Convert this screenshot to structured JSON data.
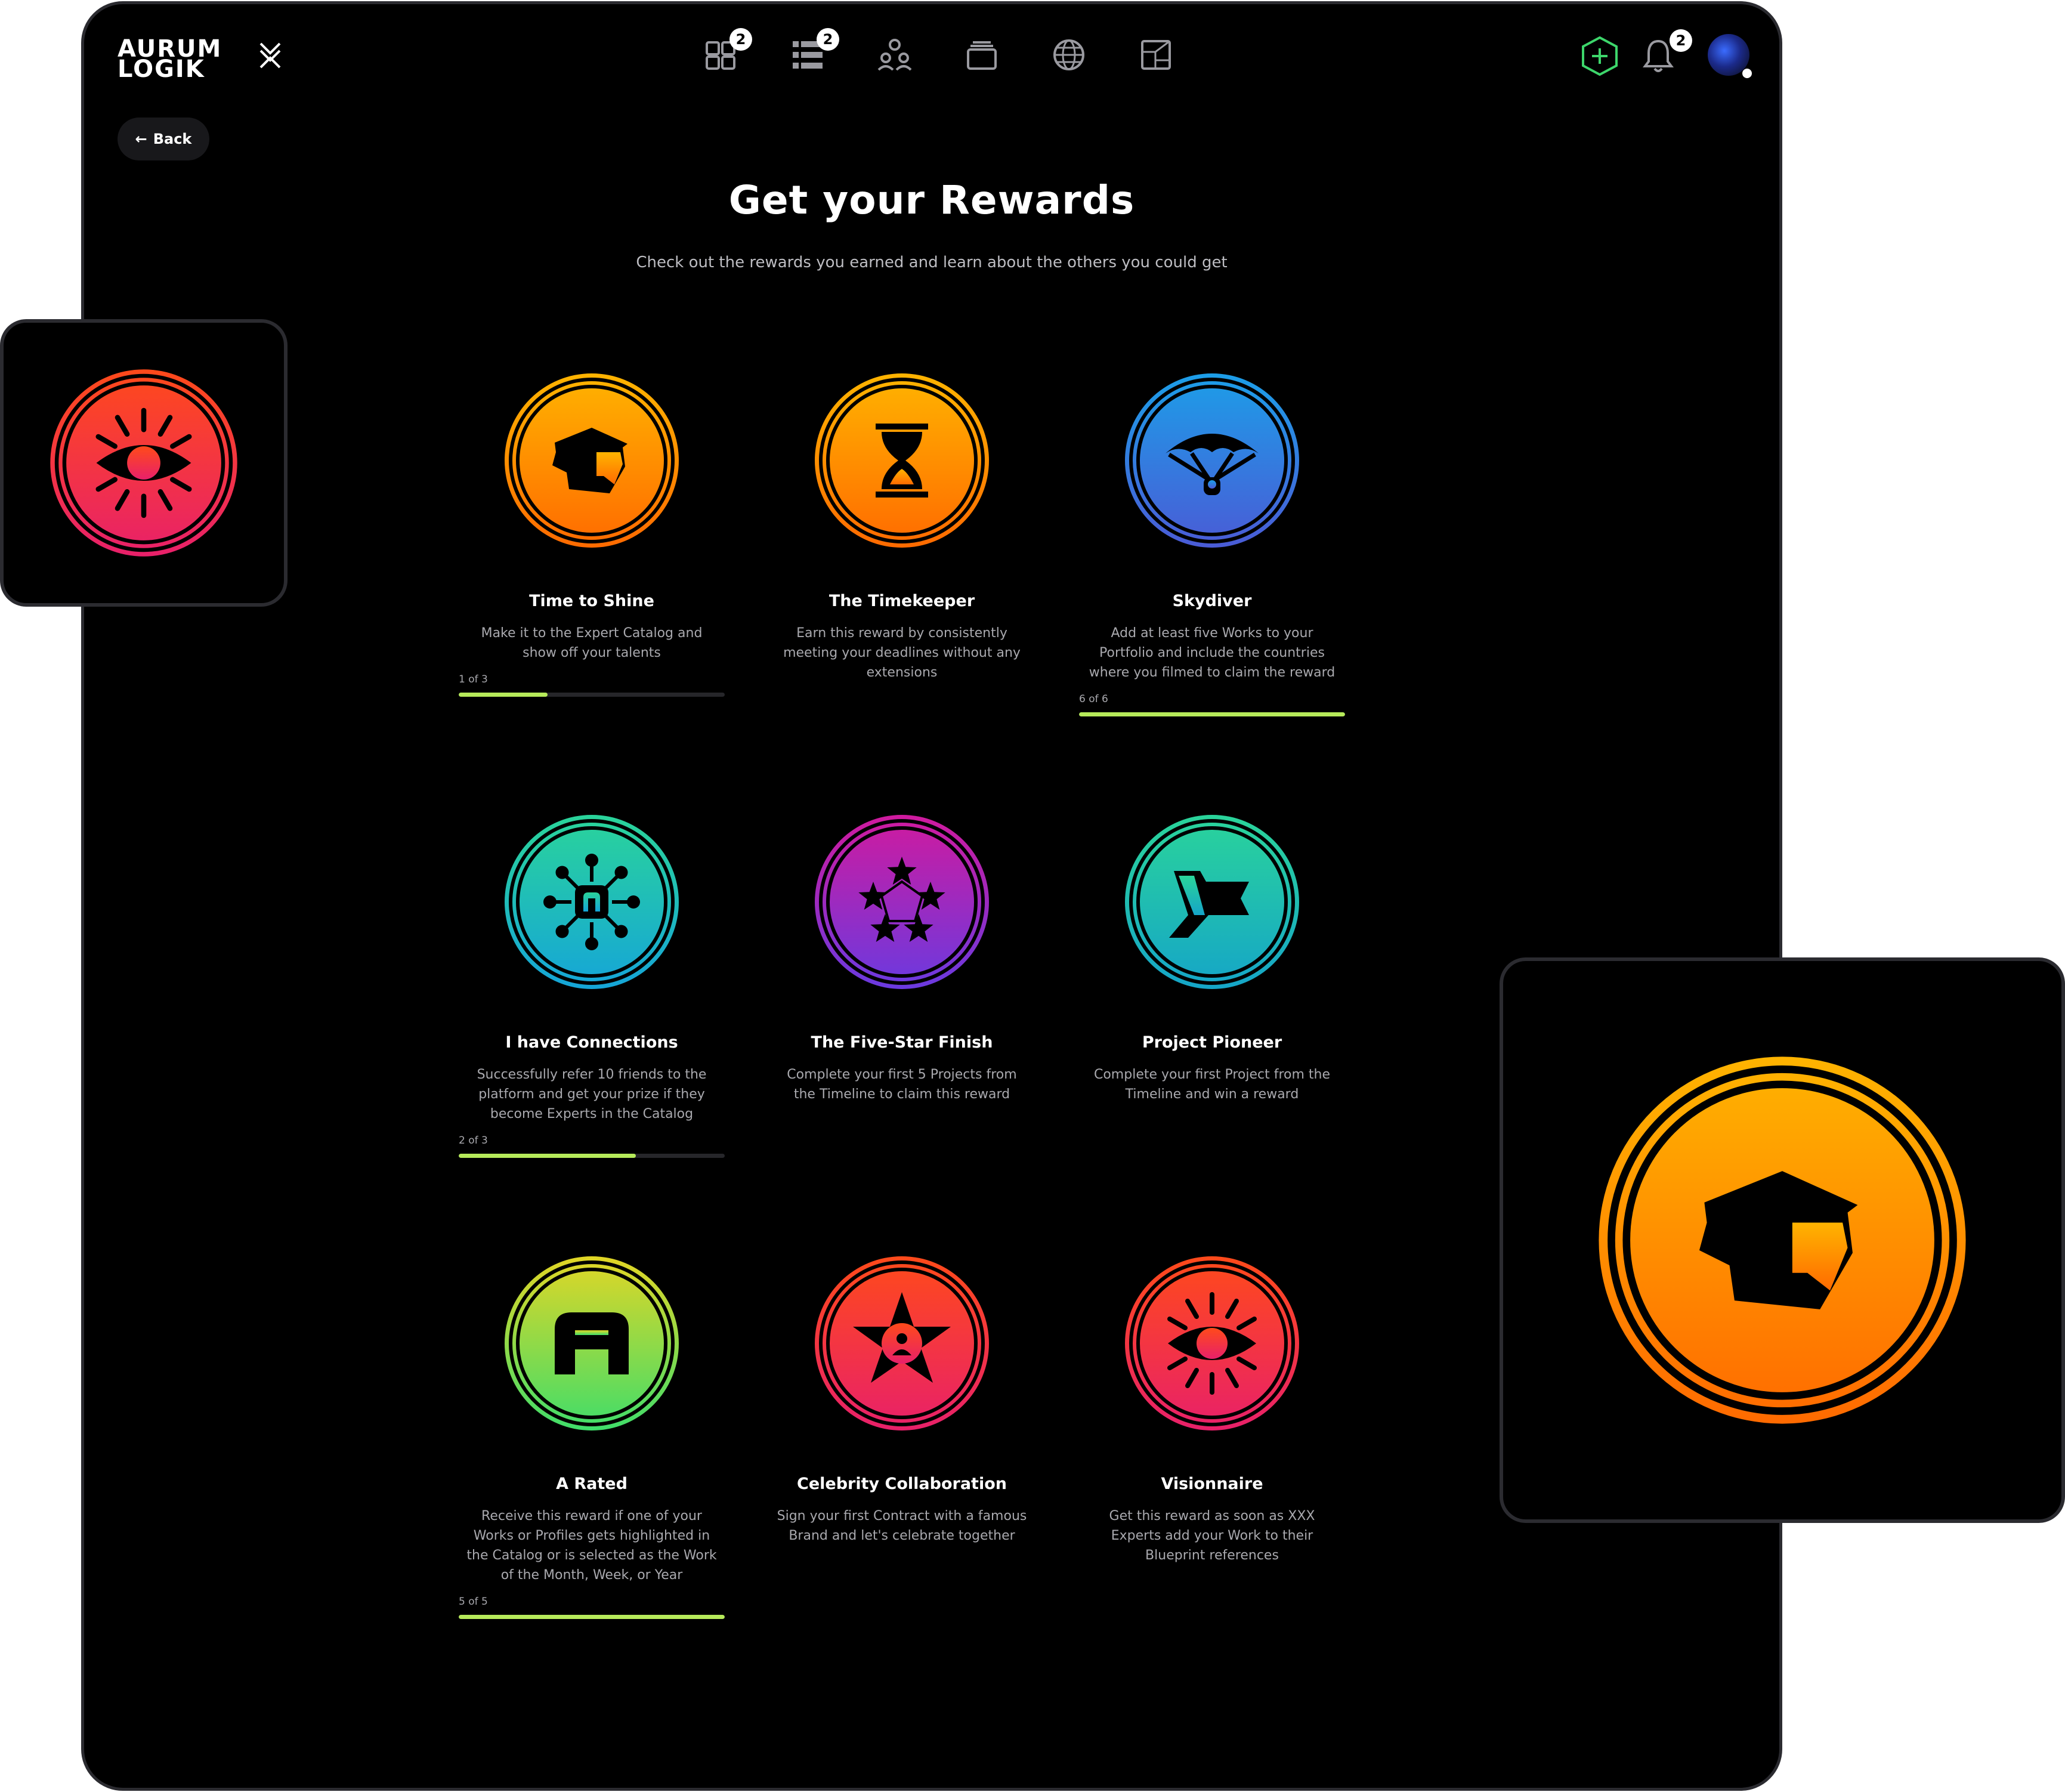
{
  "app": {
    "logo_line1": "AURUM",
    "logo_line2": "LOGIK"
  },
  "nav": {
    "items": [
      {
        "name": "dashboard",
        "badge": "2"
      },
      {
        "name": "timeline",
        "badge": "2"
      },
      {
        "name": "team",
        "badge": ""
      },
      {
        "name": "catalog",
        "badge": ""
      },
      {
        "name": "globe",
        "badge": ""
      },
      {
        "name": "blueprint",
        "badge": ""
      }
    ],
    "notifications_badge": "2"
  },
  "back_label": "Back",
  "header": {
    "title": "Get your Rewards",
    "subtitle": "Check out the rewards you earned and learn about the others you could get"
  },
  "rewards": [
    {
      "title": "Time to Shine",
      "desc": "Make it to the Expert Catalog and show off your talents",
      "progress": "1 of 3",
      "progress_fraction": 0.333,
      "colors": [
        "#ffb400",
        "#ff6a00"
      ],
      "icon": "helmet-icon"
    },
    {
      "title": "The Timekeeper",
      "desc": "Earn this reward by consistently meeting your deadlines without any extensions",
      "progress": "",
      "colors": [
        "#ffb400",
        "#ff6a00"
      ],
      "icon": "hourglass-icon"
    },
    {
      "title": "Skydiver",
      "desc": "Add at least five Works to your Portfolio and include the countries where you filmed to claim the reward",
      "progress": "6 of 6",
      "progress_fraction": 1.0,
      "colors": [
        "#1c9ee8",
        "#4a5bd6"
      ],
      "icon": "parachute-icon"
    },
    {
      "title": "I have Connections",
      "desc": "Successfully refer 10 friends to the platform and get your prize if they become Experts in the Catalog",
      "progress": "2 of 3",
      "progress_fraction": 0.667,
      "colors": [
        "#2ad49a",
        "#15a5d8"
      ],
      "icon": "network-icon"
    },
    {
      "title": "The Five-Star Finish",
      "desc": "Complete your first 5 Projects from the Timeline to claim this reward",
      "progress": "",
      "colors": [
        "#d01a9e",
        "#6a3ae0"
      ],
      "icon": "five-stars-icon"
    },
    {
      "title": "Project Pioneer",
      "desc": "Complete your first Project from the Timeline and win a reward",
      "progress": "",
      "colors": [
        "#2ad49a",
        "#15a5c8"
      ],
      "icon": "flag-icon"
    },
    {
      "title": "A Rated",
      "desc": "Receive this reward if one of your Works or Profiles gets highlighted in the Catalog or is selected as the Work of the Month, Week, or Year",
      "progress": "5 of 5",
      "progress_fraction": 1.0,
      "colors": [
        "#e2d625",
        "#3fdd6a"
      ],
      "icon": "a-rated-icon"
    },
    {
      "title": "Celebrity Collaboration",
      "desc": "Sign your first Contract with a famous Brand and let's celebrate together",
      "progress": "",
      "colors": [
        "#ff4a1a",
        "#e8206a"
      ],
      "icon": "star-person-icon"
    },
    {
      "title": "Visionnaire",
      "desc": "Get this reward as soon as XXX Experts add your Work to their Blueprint references",
      "progress": "",
      "colors": [
        "#ff4a1a",
        "#e8206a"
      ],
      "icon": "eye-icon"
    }
  ],
  "floating": [
    {
      "icon": "eye-icon",
      "colors": [
        "#ff4a1a",
        "#e8206a"
      ]
    },
    {
      "icon": "helmet-icon",
      "colors": [
        "#ffb400",
        "#ff6a00"
      ]
    }
  ]
}
